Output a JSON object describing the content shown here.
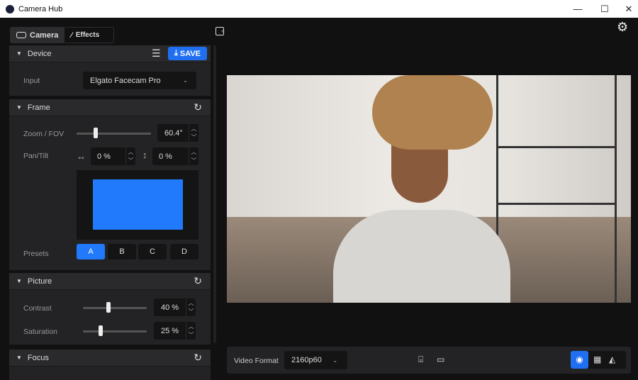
{
  "app": {
    "title": "Camera Hub"
  },
  "tabs": [
    {
      "label": "Camera"
    },
    {
      "label": "Effects"
    }
  ],
  "device": {
    "title": "Device",
    "save_label": "SAVE",
    "input_label": "Input",
    "input_value": "Elgato Facecam Pro"
  },
  "frame": {
    "title": "Frame",
    "zoom_label": "Zoom / FOV",
    "zoom_value": "60.4°",
    "zoom_fraction": 0.28,
    "pantilt_label": "Pan/Tilt",
    "pan_value": "0 %",
    "tilt_value": "0 %",
    "presets_label": "Presets",
    "presets": [
      "A",
      "B",
      "C",
      "D"
    ],
    "active_preset": "A"
  },
  "picture": {
    "title": "Picture",
    "contrast_label": "Contrast",
    "contrast_value": "40 %",
    "contrast_fraction": 0.4,
    "saturation_label": "Saturation",
    "saturation_value": "25 %",
    "saturation_fraction": 0.25
  },
  "focus": {
    "title": "Focus"
  },
  "bottom": {
    "video_format_label": "Video Format",
    "video_format_value": "2160p60"
  },
  "colors": {
    "accent": "#1f6ff0",
    "preview": "#2179fb"
  }
}
